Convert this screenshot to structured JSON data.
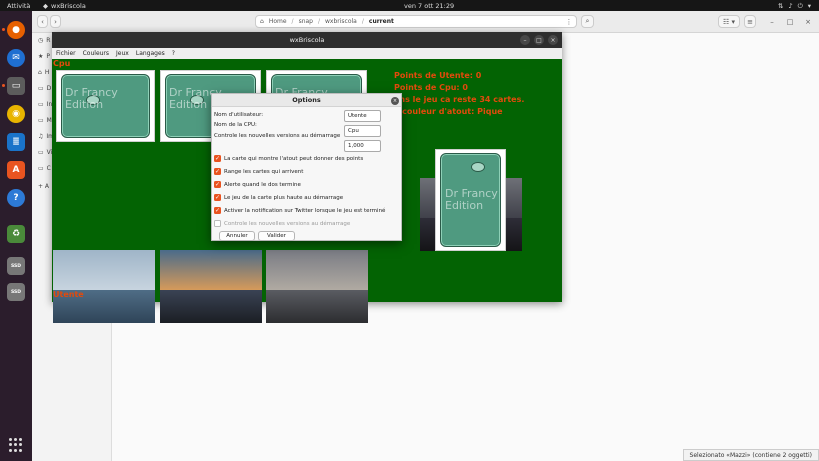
{
  "topbar": {
    "activities": "Attività",
    "app_name": "wxBriscola",
    "clock": "ven 7 ott  21:29"
  },
  "dock": {
    "items": [
      {
        "icon": "firefox-icon"
      },
      {
        "icon": "thunderbird-icon"
      },
      {
        "icon": "files-icon"
      },
      {
        "icon": "rhythmbox-icon"
      },
      {
        "icon": "writer-icon"
      },
      {
        "icon": "app-center-icon"
      },
      {
        "icon": "help-icon"
      },
      {
        "icon": "trash-icon"
      },
      {
        "icon": "ssd-drive-icon"
      },
      {
        "icon": "ssd-drive-icon"
      }
    ],
    "ssd_label": "SSD"
  },
  "file_manager": {
    "breadcrumbs": [
      "Home",
      "snap",
      "wxbriscola",
      "current"
    ],
    "sidebar_initials": [
      "R",
      "P",
      "H",
      "D",
      "In",
      "M",
      "Im",
      "Vi",
      "C",
      "+ A"
    ],
    "status": "Selezionato «Mazzi» (contiene 2 oggetti)"
  },
  "game": {
    "title": "wxBriscola",
    "menu": [
      "Fichier",
      "Couleurs",
      "Jeux",
      "Langages",
      "?"
    ],
    "cpu_label": "Cpu",
    "user_label": "Utente",
    "score_user": "Points de Utente: 0",
    "score_cpu": "Points de Cpu: 0",
    "remaining": "ans le jeu ca reste 34 cartes.",
    "trump": "a couleur d'atout: Pique",
    "card_back_text": "Dr Francy\nEdition",
    "colors": {
      "felt": "#036303",
      "text": "#e34a0c",
      "card_back": "#4f9a80"
    }
  },
  "dialog": {
    "title": "Options",
    "fields": [
      {
        "label": "Nom d'utilisateur:",
        "value": "Utente"
      },
      {
        "label": "Nom de la CPU:",
        "value": "Cpu"
      },
      {
        "label": "Controle les nouvelles versions au démarrage",
        "value": "1,000"
      }
    ],
    "checkboxes": [
      {
        "label": "La carte qui montre l'atout peut donner des points",
        "checked": true
      },
      {
        "label": "Range les cartes qui arrivent",
        "checked": true
      },
      {
        "label": "Alerte quand le dos termine",
        "checked": true
      },
      {
        "label": "Le jeu de la carte plus haute au démarrage",
        "checked": true
      },
      {
        "label": "Activer la notification sur Twitter lorsque le jeu est terminé",
        "checked": true
      },
      {
        "label": "Controle les nouvelles versions au démarrage",
        "checked": false
      }
    ],
    "cancel": "Annuler",
    "ok": "Valider"
  }
}
